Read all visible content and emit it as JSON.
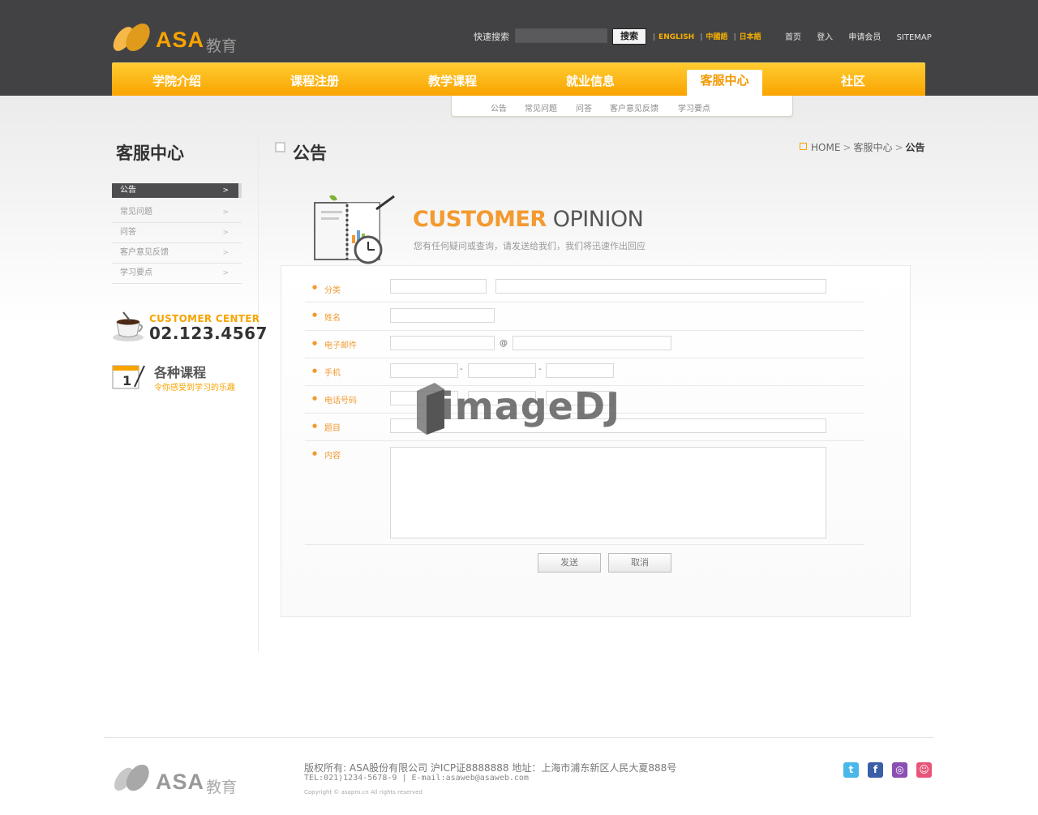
{
  "header": {
    "brand": "ASA",
    "brand_sub": "教育",
    "search_label": "快速搜索",
    "search_placeholder": "",
    "search_button": "搜索",
    "languages": [
      "ENGLISH",
      "中國語",
      "日本語"
    ],
    "top_links": [
      "首页",
      "登入",
      "申请会员",
      "SITEMAP"
    ]
  },
  "nav": {
    "items": [
      "学院介绍",
      "课程注册",
      "教学课程",
      "就业信息",
      "客服中心",
      "社区"
    ],
    "active_index": 4
  },
  "subnav": [
    "公告",
    "常见问题",
    "问答",
    "客户意见反馈",
    "学习要点"
  ],
  "sidebar": {
    "title": "客服中心",
    "items": [
      {
        "label": "公告",
        "active": true
      },
      {
        "label": "常见问题",
        "active": false
      },
      {
        "label": "问答",
        "active": false
      },
      {
        "label": "客户意见反馈",
        "active": false
      },
      {
        "label": "学习要点",
        "active": false
      }
    ],
    "customer_center_label": "CUSTOMER CENTER",
    "customer_center_phone": "02.123.4567",
    "course_title": "各种课程",
    "course_sub": "令你感受到学习的乐趣"
  },
  "main": {
    "title": "公告",
    "breadcrumb": [
      "HOME",
      "客服中心",
      "公告"
    ],
    "banner_title_a": "CUSTOMER",
    "banner_title_b": " OPINION",
    "banner_sub": "您有任何疑问或查询，请发送给我们，我们将迅速作出回应"
  },
  "form": {
    "fields": [
      "分类",
      "姓名",
      "电子邮件",
      "手机",
      "电话号码",
      "题目",
      "内容"
    ],
    "at_sign": "@",
    "dash": "-",
    "send_button": "发送",
    "cancel_button": "取消"
  },
  "watermark": "imageDJ",
  "footer": {
    "brand": "ASA",
    "brand_sub": "教育",
    "copyright_line1": "版权所有: ASA股份有限公司 沪ICP证8888888 地址：上海市浦东新区人民大夏888号",
    "copyright_line2": "TEL:021)1234-5678-9 | E-mail:asaweb@asaweb.com",
    "copyright_line3": "Copyright © asapro.cn All rights reserved",
    "social": [
      {
        "name": "twitter",
        "glyph": "t",
        "color": "#49b8e9"
      },
      {
        "name": "facebook",
        "glyph": "f",
        "color": "#3b5ea8"
      },
      {
        "name": "blog",
        "glyph": "◎",
        "color": "#8b4fb4"
      },
      {
        "name": "me2day",
        "glyph": "☺",
        "color": "#e9557a"
      }
    ]
  }
}
